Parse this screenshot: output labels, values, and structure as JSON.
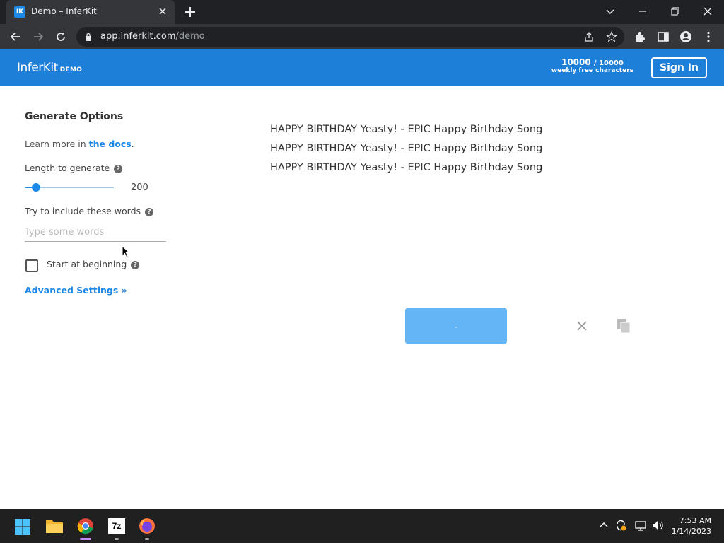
{
  "browser": {
    "tab_title": "Demo – InferKit",
    "tab_favicon_text": "IK",
    "url_host": "app.inferkit.com",
    "url_path": "/demo"
  },
  "header": {
    "logo": "InferKit",
    "logo_badge": "DEMO",
    "quota_used": "10000",
    "quota_total": "/ 10000",
    "quota_label": "weekly free characters",
    "signin_label": "Sign In"
  },
  "options": {
    "title": "Generate Options",
    "learn_prefix": "Learn more in ",
    "learn_link": "the docs",
    "learn_suffix": ".",
    "length_label": "Length to generate",
    "length_value": "200",
    "length_fraction": 0.11,
    "words_label": "Try to include these words",
    "words_placeholder": "Type some words",
    "words_value": "",
    "start_label": "Start at beginning",
    "start_checked": false,
    "advanced_label": "Advanced Settings »",
    "help_glyph": "?"
  },
  "output": {
    "lines": [
      "HAPPY BIRTHDAY Yeasty! - EPIC Happy Birthday Song",
      "HAPPY BIRTHDAY Yeasty! - EPIC Happy Birthday Song",
      "HAPPY BIRTHDAY Yeasty! - EPIC Happy Birthday Song"
    ],
    "generate_label": "-"
  },
  "taskbar": {
    "time": "7:53 AM",
    "date": "1/14/2023",
    "sevenzip_label": "7z"
  },
  "colors": {
    "brand": "#1e7fd9",
    "link": "#1e88e5",
    "button": "#64b5f6"
  }
}
